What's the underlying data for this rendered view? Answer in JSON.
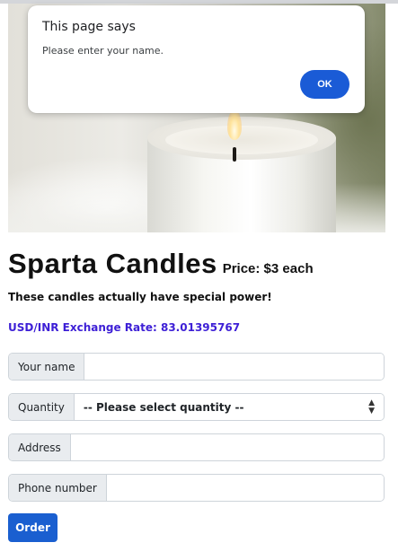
{
  "dialog": {
    "title": "This page says",
    "message": "Please enter your name.",
    "ok_label": "OK"
  },
  "product": {
    "name": "Sparta Candles",
    "price": "Price: $3 each",
    "tagline": "These candles actually have special power!",
    "exchange_rate": "USD/INR Exchange Rate: 83.01395767"
  },
  "form": {
    "name_label": "Your name",
    "name_value": "",
    "quantity_label": "Quantity",
    "quantity_selected": "-- Please select quantity --",
    "address_label": "Address",
    "address_value": "",
    "phone_label": "Phone number",
    "phone_value": "",
    "order_label": "Order"
  },
  "colors": {
    "ok_button": "#1a5bd6",
    "order_button": "#1a5fd0",
    "exchange_rate_text": "#3d1fd6"
  }
}
